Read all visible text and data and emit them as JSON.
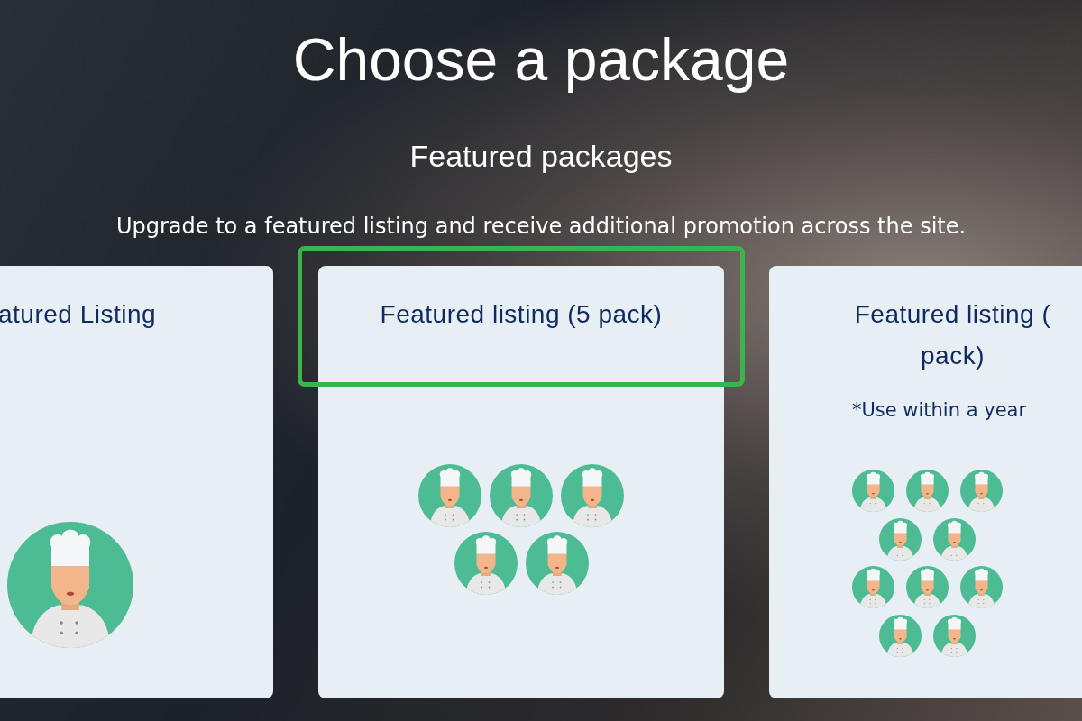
{
  "heading": "Choose a package",
  "section_title": "Featured packages",
  "description": "Upgrade to a featured listing and receive additional promotion across the site.",
  "packages": [
    {
      "title_lines": [
        "atured Listing"
      ],
      "highlighted": false,
      "kind": "single"
    },
    {
      "title_lines": [
        "Featured listing (5 pack)"
      ],
      "highlighted": true,
      "kind": "group_5"
    },
    {
      "title_lines": [
        "Featured listing (",
        "pack)"
      ],
      "note": "*Use within a year",
      "highlighted": false,
      "kind": "group_10"
    }
  ]
}
